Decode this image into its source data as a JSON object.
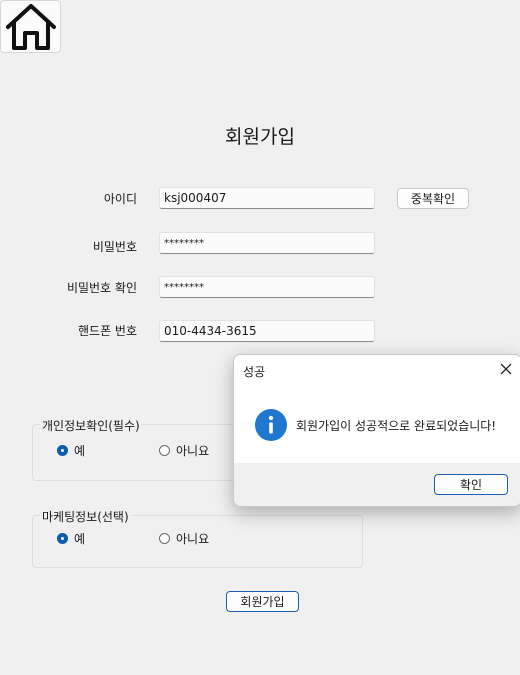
{
  "page": {
    "title": "회원가입"
  },
  "form": {
    "id_label": "아이디",
    "id_value": "ksj000407",
    "dup_check_label": "중복확인",
    "pw_label": "비밀번호",
    "pw_value": "********",
    "pw_confirm_label": "비밀번호 확인",
    "pw_confirm_value": "********",
    "phone_label": "핸드폰 번호",
    "phone_value": "010-4434-3615"
  },
  "privacy_group": {
    "legend": "개인정보확인(필수)",
    "yes_label": "예",
    "no_label": "아니요",
    "selected": "yes"
  },
  "marketing_group": {
    "legend": "마케팅정보(선택)",
    "yes_label": "예",
    "no_label": "아니요",
    "selected": "yes"
  },
  "submit_label": "회원가입",
  "dialog": {
    "title": "성공",
    "message": "회원가입이 성공적으로 완료되었습니다!",
    "ok_label": "확인"
  },
  "colors": {
    "accent": "#1a5fb4",
    "radio_selected": "#0b5cad",
    "info_icon": "#1f77d0"
  }
}
